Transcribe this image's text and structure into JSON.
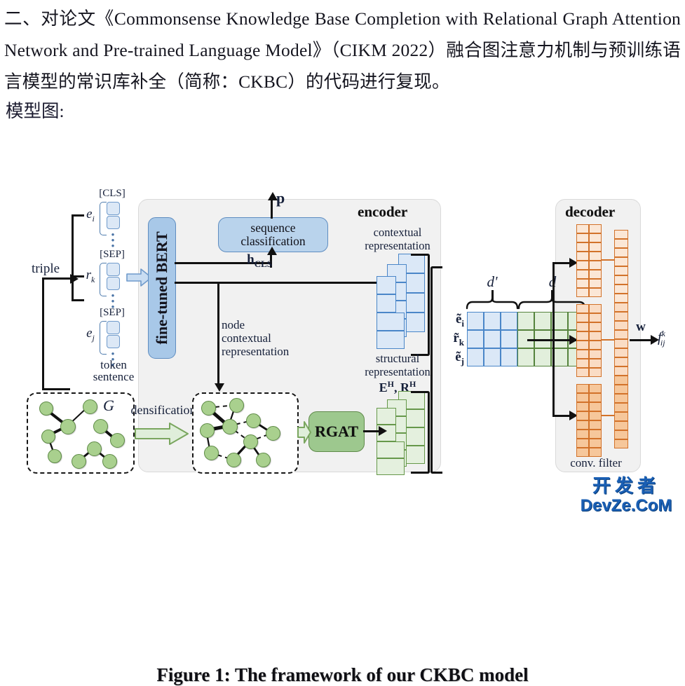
{
  "document": {
    "paragraph_prefix": "二、对论文",
    "paper_title": "《Commonsense Knowledge Base Completion with Relational Graph Attention Network and Pre-trained Language Model》",
    "venue": "（CIKM 2022）",
    "paragraph_suffix": "融合图注意力机制与预训练语言模型的常识库补全（简称：CKBC）的代码进行复现。",
    "full_paragraph": "二、对论文《Commonsense Knowledge Base Completion with Relational Graph Attention Network and Pre-trained Language Model》（CIKM 2022）融合图注意力机制与预训练语言模型的常识库补全（简称：CKBC）的代码进行复现。",
    "section_label": "模型图:"
  },
  "figure": {
    "caption": "Figure 1: The framework of our CKBC model",
    "panels": {
      "encoder_title": "encoder",
      "decoder_title": "decoder"
    },
    "input": {
      "triple_label": "triple",
      "entity_head": "e",
      "entity_head_sub": "i",
      "relation": "r",
      "relation_sub": "k",
      "entity_tail": "e",
      "entity_tail_sub": "j",
      "cls_token": "[CLS]",
      "sep_token_1": "[SEP]",
      "sep_token_2": "[SEP]",
      "token_caption_line1": "token",
      "token_caption_line2": "sentence"
    },
    "encoder": {
      "bert_label": "fine-tuned BERT",
      "seq_cls_line1": "sequence",
      "seq_cls_line2": "classification",
      "output_p": "p",
      "h_cls_bold": "h",
      "h_cls_sub": "CLS",
      "node_ctx_line1": "node",
      "node_ctx_line2": "contextual",
      "node_ctx_line3": "representation",
      "contextual_line1": "contextual",
      "contextual_line2": "representation",
      "structural_line1": "structural",
      "structural_line2": "representation",
      "structural_symbols": "E^H, R^H",
      "structural_sym_E": "E",
      "structural_sym_R": "R",
      "structural_sym_sup": "H",
      "rgat_label": "RGAT",
      "graph_symbol": "G",
      "densification_label": "densification"
    },
    "fusion": {
      "row_labels": [
        "ẽ",
        "r̃",
        "ẽ"
      ],
      "row_subs": [
        "i",
        "k",
        "j"
      ],
      "brace_left_label": "d'",
      "brace_right_label": "d",
      "blue_cols": 3,
      "green_cols": 4,
      "rows": 3
    },
    "decoder": {
      "conv_filter_label": "conv. filter",
      "weight_label": "w",
      "score_label": "f",
      "score_sup": "k",
      "score_sub": "ij",
      "filter_blocks": 3,
      "filter_cols": 2,
      "filter_rows": 8,
      "output_col_rows": 24
    },
    "colors": {
      "panel_bg": "#f1f1f1",
      "blue_fill": "#dbe8f7",
      "blue_stroke": "#4a86c8",
      "bert_fill": "#a8c8e8",
      "green_fill": "#e2efdc",
      "green_stroke": "#55833c",
      "rgat_fill": "#9dc88e",
      "node_fill": "#a9d08e",
      "orange_stroke": "#d2722a",
      "line": "#111111"
    }
  },
  "watermark": {
    "cn_text": "开发者",
    "en_text": "DevZe.CoM",
    "color": "#1a5fb4"
  }
}
